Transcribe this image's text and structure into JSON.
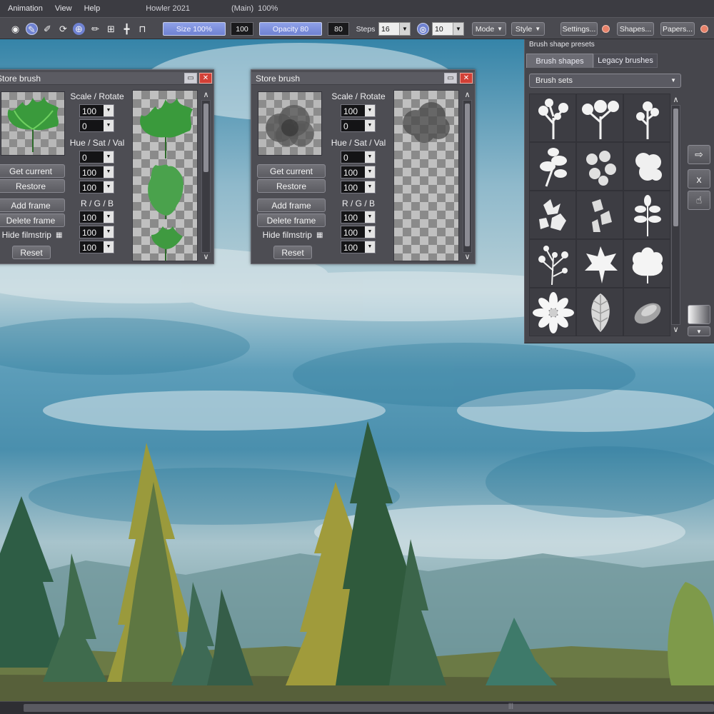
{
  "menubar": {
    "items": [
      "Animation",
      "View",
      "Help"
    ],
    "app_title": "Howler 2021",
    "doc_title": "(Main)",
    "zoom": "100%"
  },
  "toolbar": {
    "size_label": "Size 100%",
    "size_value": "100",
    "opacity_label": "Opacity 80",
    "opacity_value": "80",
    "steps_label": "Steps",
    "steps_value": "16",
    "second_value": "10",
    "mode_label": "Mode",
    "style_label": "Style",
    "settings_label": "Settings...",
    "shapes_label": "Shapes...",
    "papers_label": "Papers...",
    "dot_color": "#e8826a"
  },
  "store_brush_left": {
    "title": "Store brush",
    "scale_rotate_label": "Scale / Rotate",
    "scale": "100",
    "rotate": "0",
    "hsv_label": "Hue / Sat / Val",
    "hue": "0",
    "sat": "100",
    "val": "100",
    "rgb_label": "R / G / B",
    "r": "100",
    "g": "100",
    "b": "100",
    "get_current": "Get current",
    "restore": "Restore",
    "add_frame": "Add frame",
    "delete_frame": "Delete frame",
    "hide_filmstrip": "Hide filmstrip",
    "reset": "Reset"
  },
  "store_brush_right": {
    "title": "Store brush",
    "scale_rotate_label": "Scale / Rotate",
    "scale": "100",
    "rotate": "0",
    "hsv_label": "Hue / Sat / Val",
    "hue": "0",
    "sat": "100",
    "val": "100",
    "rgb_label": "R / G / B",
    "r": "100",
    "g": "100",
    "b": "100",
    "get_current": "Get current",
    "restore": "Restore",
    "add_frame": "Add frame",
    "delete_frame": "Delete frame",
    "hide_filmstrip": "Hide filmstrip",
    "reset": "Reset"
  },
  "presets_panel": {
    "title": "Brush shape presets",
    "tabs": [
      "Brush shapes",
      "Legacy brushes"
    ],
    "active_tab": "Brush shapes",
    "sets_combo": "Brush sets",
    "side_buttons": [
      "arrow-right-icon",
      "x",
      "hand-icon",
      "gradient-icon",
      "chevron-down-icon"
    ],
    "close_label": "x"
  },
  "colors": {
    "panel_bg": "#4d4d53",
    "slider_accent": "#7f92de",
    "close_red": "#d24036"
  }
}
